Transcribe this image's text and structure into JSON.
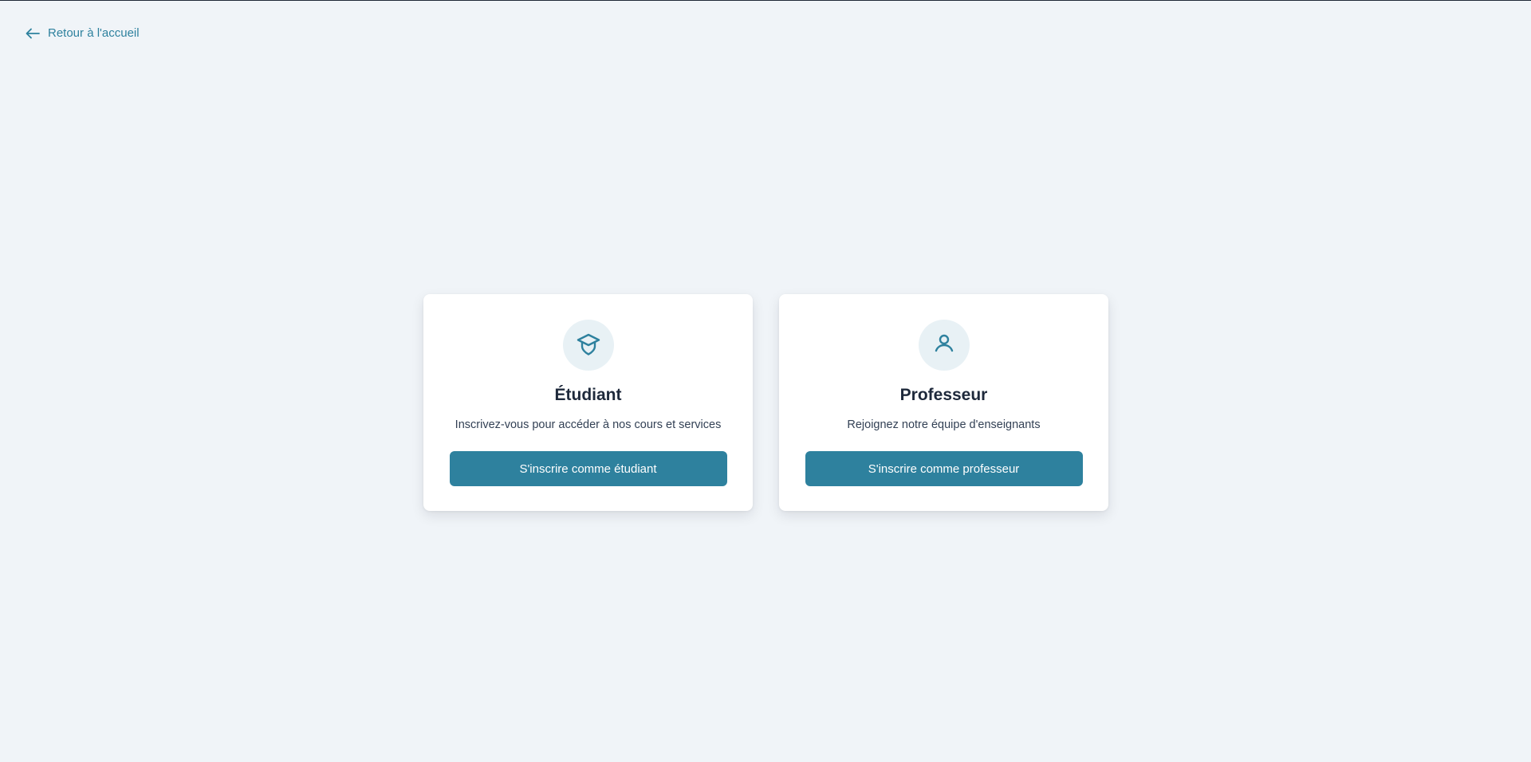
{
  "nav": {
    "back_icon": "arrow-left-icon",
    "back_label": "Retour à l'accueil"
  },
  "cards": [
    {
      "icon": "graduation-cap-icon",
      "title": "Étudiant",
      "description": "Inscrivez-vous pour accéder à nos cours et services",
      "button_label": "S'inscrire comme étudiant"
    },
    {
      "icon": "user-icon",
      "title": "Professeur",
      "description": "Rejoignez notre équipe d'enseignants",
      "button_label": "S'inscrire comme professeur"
    }
  ],
  "colors": {
    "accent": "#2e819e",
    "background": "#f0f4f8",
    "icon_circle": "#e8f1f5",
    "heading": "#1e293b"
  }
}
